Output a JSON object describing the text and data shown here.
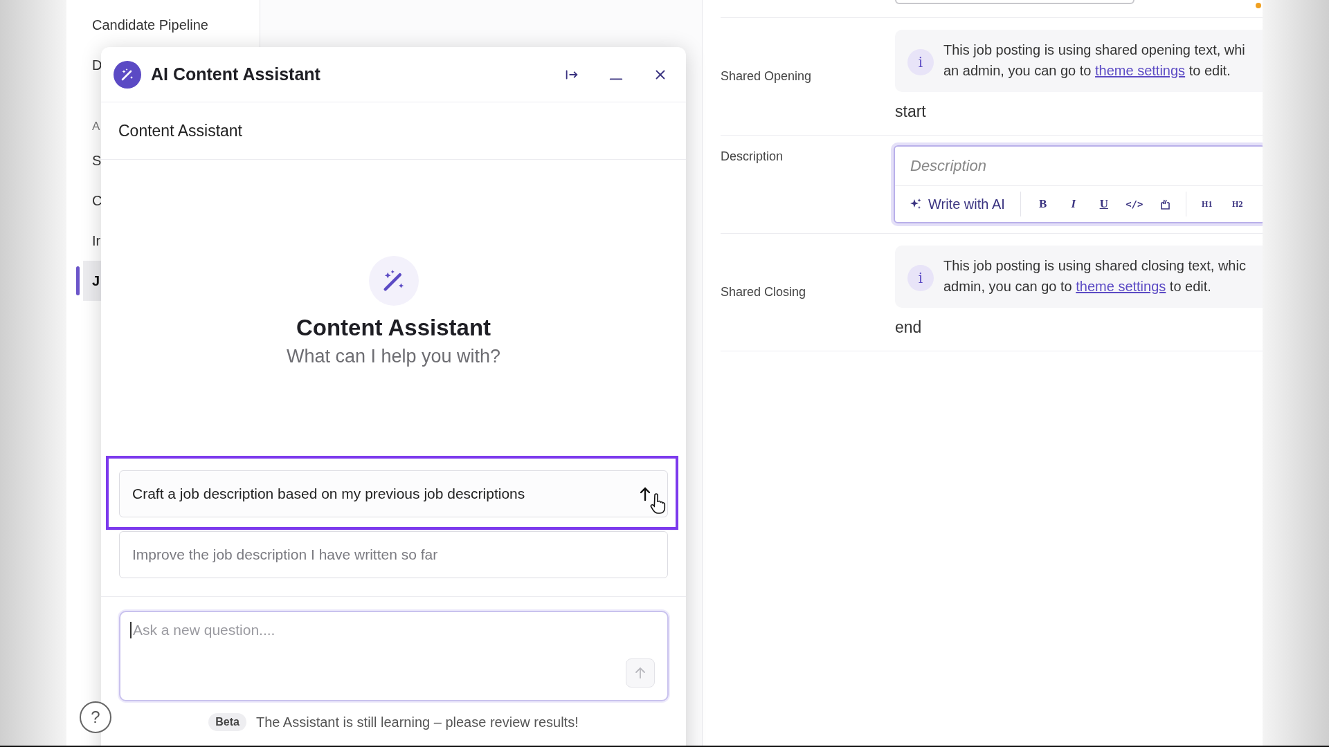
{
  "sidebar": {
    "items": [
      {
        "label": "Candidate Pipeline",
        "kind": "link",
        "selected": false
      },
      {
        "label": "D",
        "kind": "link",
        "selected": false
      },
      {
        "label": "A",
        "kind": "header"
      },
      {
        "label": "S",
        "kind": "link",
        "selected": false
      },
      {
        "label": "C",
        "kind": "link",
        "selected": false
      },
      {
        "label": "Ir",
        "kind": "link",
        "selected": false
      },
      {
        "label": "J",
        "kind": "link",
        "selected": true
      }
    ]
  },
  "assistant": {
    "title": "AI Content Assistant",
    "subheader": "Content Assistant",
    "heading": "Content Assistant",
    "subheading": "What can I help you with?",
    "suggestions": [
      {
        "text": "Craft a job description based on my previous job descriptions",
        "highlighted": true
      },
      {
        "text": "Improve the job description I have written so far",
        "highlighted": false
      }
    ],
    "input": {
      "placeholder": "Ask a new question...."
    },
    "footer": {
      "badge": "Beta",
      "note": "The Assistant is still learning – please review results!"
    },
    "help_button": "?"
  },
  "form": {
    "rows": [
      {
        "kind": "notice",
        "label": "Shared Opening",
        "icon_char": "i",
        "line_1": "This job posting is using shared opening text, whi",
        "line_2_before": "an admin, you can go to ",
        "link": "theme settings",
        "line_2_after": " to edit.",
        "value": "start"
      },
      {
        "kind": "editor",
        "label": "Description",
        "placeholder": "Description",
        "ai_button": "Write with AI",
        "format_buttons": [
          "B",
          "I",
          "U",
          "</>"
        ],
        "heading_buttons": [
          "H1",
          "H2"
        ]
      },
      {
        "kind": "notice",
        "label": "Shared Closing",
        "icon_char": "i",
        "line_1": "This job posting is using shared closing text, whic",
        "line_2_before": "admin, you can go to ",
        "link": "theme settings",
        "line_2_after": " to edit.",
        "value": "end"
      }
    ]
  }
}
